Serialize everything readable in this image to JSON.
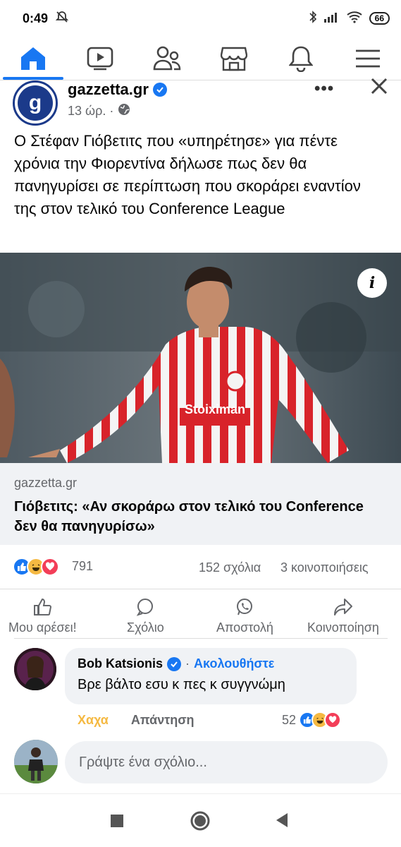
{
  "status_bar": {
    "time": "0:49",
    "battery": "66"
  },
  "nav": {
    "items": [
      {
        "name": "home",
        "active": true
      },
      {
        "name": "watch"
      },
      {
        "name": "friends"
      },
      {
        "name": "marketplace"
      },
      {
        "name": "notifications"
      },
      {
        "name": "menu"
      }
    ]
  },
  "post": {
    "page_name": "gazzetta.gr",
    "logo_letter": "g",
    "time": "13 ώρ. ·",
    "more": "•••",
    "text": "Ο Στέφαν Γιόβετιτς που «υπηρέτησε» για πέντε χρόνια την Φιορεντίνα δήλωσε πως δεν θα πανηγυρίσει σε περίπτωση που σκοράρει εναντίον της στον τελικό του Conference League",
    "image_info": "i",
    "jersey_text": "Stoiximan",
    "link": {
      "domain": "gazzetta.gr",
      "title": "Γιόβετιτς: «Αν σκοράρω στον τελικό του Conference δεν θα πανηγυρίσω»"
    },
    "stats": {
      "reactions": "791",
      "comments": "152 σχόλια",
      "shares": "3 κοινοποιήσεις"
    },
    "actions": {
      "like": "Μου αρέσει!",
      "comment": "Σχόλιο",
      "send": "Αποστολή",
      "share": "Κοινοποίηση"
    }
  },
  "comment": {
    "author": "Bob Katsionis",
    "follow": "Ακολουθήστε",
    "follow_sep": "·",
    "text": "Βρε βάλτο εσυ κ πες κ συγγνώμη",
    "haha": "Χαχα",
    "reply": "Απάντηση",
    "reaction_count": "52"
  },
  "compose": {
    "placeholder": "Γράψτε ένα σχόλιο..."
  },
  "colors": {
    "accent": "#1877f2",
    "haha": "#f5b942",
    "love": "#f33e58"
  }
}
